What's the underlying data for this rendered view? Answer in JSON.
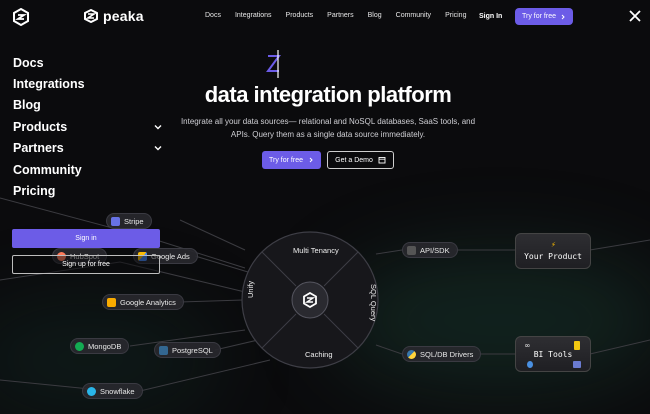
{
  "brand": {
    "name": "peaka"
  },
  "nav": {
    "links": [
      "Docs",
      "Integrations",
      "Products",
      "Partners",
      "Blog",
      "Community",
      "Pricing"
    ],
    "signin": "Sign In",
    "try": "Try for free"
  },
  "menu": {
    "items": [
      {
        "label": "Docs"
      },
      {
        "label": "Integrations"
      },
      {
        "label": "Blog"
      },
      {
        "label": "Products"
      },
      {
        "label": "Partners"
      },
      {
        "label": "Community"
      },
      {
        "label": "Pricing"
      }
    ],
    "signin": "Sign in",
    "signup": "Sign up for free"
  },
  "hero": {
    "mark": "Z",
    "title": "data integration platform",
    "subtitle": "Integrate all your data sources— relational and NoSQL databases, SaaS tools, and APIs. Query them as a single data source immediately.",
    "try": "Try for free",
    "demo": "Get a Demo"
  },
  "diagram": {
    "sources": [
      {
        "label": "Stripe",
        "color": "#6772e5"
      },
      {
        "label": "HubSpot",
        "color": "#ff7a59"
      },
      {
        "label": "Google Ads",
        "color": "#fbbc04"
      },
      {
        "label": "Google Analytics",
        "color": "#f9ab00"
      },
      {
        "label": "MongoDB",
        "color": "#13aa52"
      },
      {
        "label": "PostgreSQL",
        "color": "#336791"
      },
      {
        "label": "Snowflake",
        "color": "#29b5e8"
      }
    ],
    "segments": {
      "top": "Multi Tenancy",
      "right": "SQL Query",
      "bottom": "Caching",
      "left": "Unify"
    },
    "outputs": [
      {
        "label": "API/SDK"
      },
      {
        "label": "SQL/DB Drivers"
      }
    ],
    "cards": {
      "product": "Your Product",
      "bi": "BI Tools"
    }
  },
  "colors": {
    "accent": "#6c5ce7",
    "background": "#0b0b0d"
  }
}
